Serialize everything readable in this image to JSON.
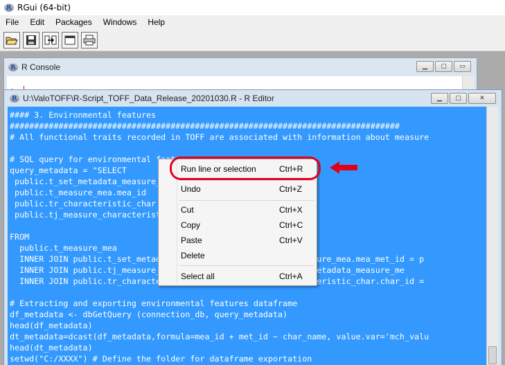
{
  "app": {
    "title": "RGui (64-bit)",
    "logo": "R"
  },
  "menubar": {
    "items": [
      "File",
      "Edit",
      "Packages",
      "Windows",
      "Help"
    ]
  },
  "toolbar": {
    "icons": [
      "open-folder-icon",
      "save-icon",
      "load-workspace-icon",
      "window-icon",
      "print-icon"
    ]
  },
  "console": {
    "title": "R Console",
    "prompt": ">"
  },
  "editor": {
    "title": "U:\\ValoTOFF\\R-Script_TOFF_Data_Release_20201030.R - R Editor",
    "lines": [
      "#### 3. Environmental features",
      "################################################################################",
      "# All functional traits recorded in TOFF are associated with information about measure",
      "",
      "# SQL query for environmental features",
      "query_metadata = \"SELECT",
      " public.t_set_metadata_measure_mea",
      " public.t_measure_mea.mea_id",
      " public.tr_characteristic_char",
      " public.tj_measure_characteristic",
      "",
      "FROM",
      "  public.t_measure_mea",
      "  INNER JOIN public.t_set_metadata_measure_mea ON public.t_measure_mea.mea_met_id = p",
      "  INNER JOIN public.tj_measure_characteristic ON public.t_set_metadata_measure_me",
      "  INNER JOIN public.tr_characteristic_char ON public.tr_characteristic_char.char_id =",
      "",
      "# Extracting and exporting environmental features dataframe",
      "df_metadata <- dbGetQuery (connection_db, query_metadata)",
      "head(df_metadata)",
      "dt_metadata=dcast(df_metadata,formula=mea_id + met_id ~ char_name, value.var='mch_valu",
      "head(dt_metadata)",
      "setwd(\"C:/XXXX\") # Define the folder for dataframe exportation"
    ]
  },
  "context_menu": {
    "items": [
      {
        "label": "Run line or selection",
        "shortcut": "Ctrl+R"
      },
      {
        "label": "Undo",
        "shortcut": "Ctrl+Z"
      },
      {
        "label": "Cut",
        "shortcut": "Ctrl+X"
      },
      {
        "label": "Copy",
        "shortcut": "Ctrl+C"
      },
      {
        "label": "Paste",
        "shortcut": "Ctrl+V"
      },
      {
        "label": "Delete",
        "shortcut": ""
      },
      {
        "label": "Select all",
        "shortcut": "Ctrl+A"
      }
    ]
  },
  "colors": {
    "selection": "#3399ff",
    "annotation": "#e0001a",
    "prompt": "#e00000"
  }
}
